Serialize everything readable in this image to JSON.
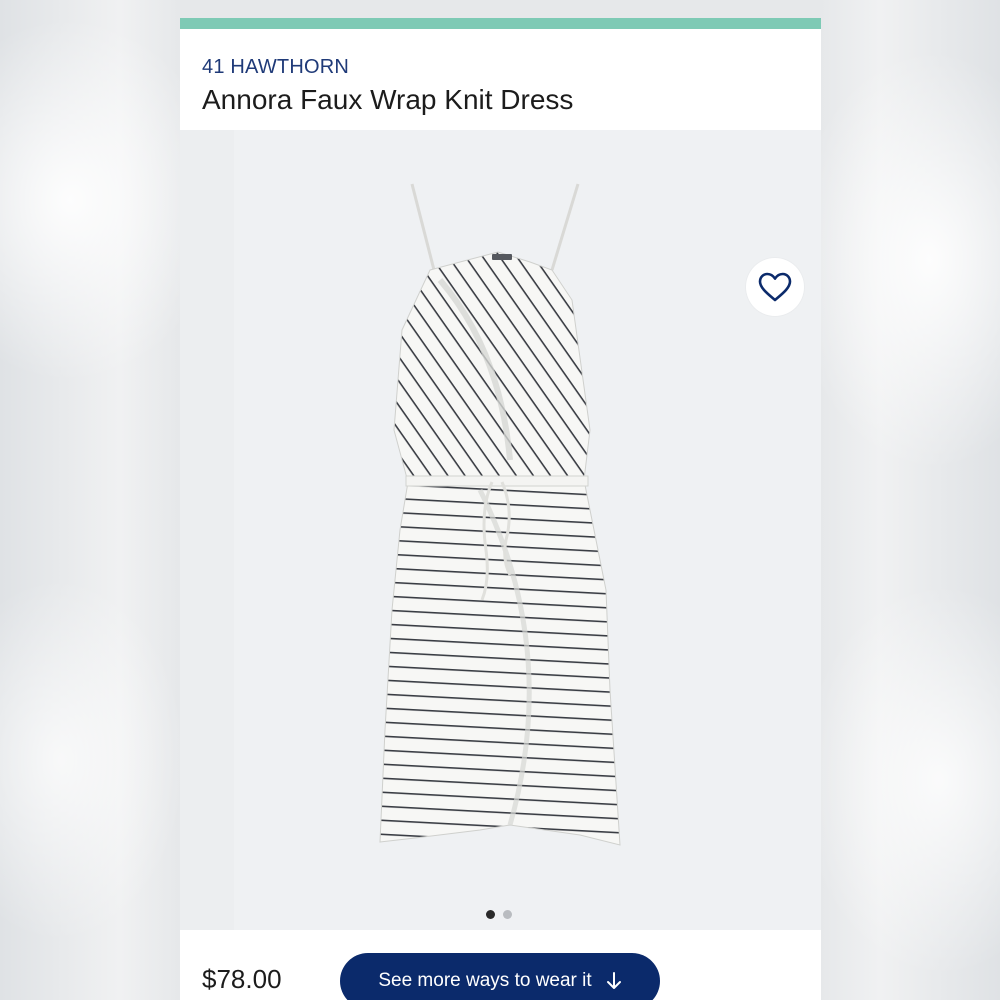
{
  "product": {
    "brand": "41 HAWTHORN",
    "title": "Annora Faux Wrap Knit Dress",
    "price": "$78.00"
  },
  "actions": {
    "favorite_icon": "heart-outline-icon",
    "cta_label": "See more ways to wear it",
    "cta_icon": "arrow-down-icon"
  },
  "carousel": {
    "total": 2,
    "active_index": 0
  },
  "colors": {
    "accent": "#7ecab5",
    "brand_text": "#1f3a78",
    "cta_background": "#0b2a6b",
    "heart": "#0b2a6b"
  }
}
